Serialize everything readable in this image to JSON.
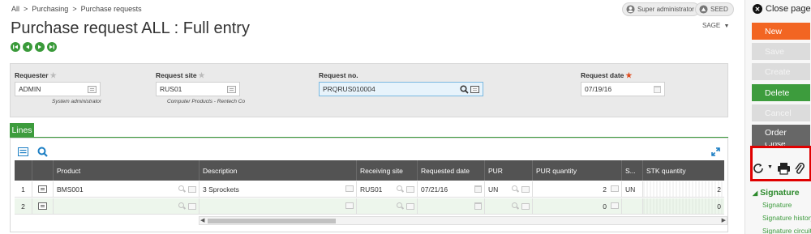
{
  "breadcrumb": [
    "All",
    "Purchasing",
    "Purchase requests"
  ],
  "breadcrumb_sep": ">",
  "user_badge": "Super administrator",
  "folder_badge": "SEED",
  "company_menu": "SAGE",
  "page_title": "Purchase request ALL : Full entry",
  "nav_buttons": [
    "first-record-icon",
    "previous-record-icon",
    "next-record-icon",
    "last-record-icon"
  ],
  "form": {
    "requester": {
      "label": "Requester",
      "value": "ADMIN",
      "desc": "System administrator"
    },
    "request_site": {
      "label": "Request site",
      "value": "RUS01",
      "desc": "Computer Products - Rentech Co"
    },
    "request_no": {
      "label": "Request no.",
      "value": "PRQRUS010004"
    },
    "request_date": {
      "label": "Request date",
      "value": "07/19/16"
    }
  },
  "lines_tab": "Lines",
  "grid": {
    "columns": [
      "Product",
      "Description",
      "Receiving site",
      "Requested date",
      "PUR",
      "PUR quantity",
      "S...",
      "STK quantity"
    ],
    "rows": [
      {
        "num": "1",
        "product": "BMS001",
        "description": "3 Sprockets",
        "site": "RUS01",
        "date": "07/21/16",
        "pur": "UN",
        "pur_qty": "2",
        "s": "UN",
        "stk_qty": "2"
      },
      {
        "num": "2",
        "product": "",
        "description": "",
        "site": "",
        "date": "",
        "pur": "",
        "pur_qty": "0",
        "s": "",
        "stk_qty": "0"
      }
    ]
  },
  "actions": {
    "close": "Close page",
    "new": "New",
    "save": "Save",
    "create": "Create",
    "delete": "Delete",
    "cancel": "Cancel",
    "order": "Order",
    "close_action": "Close"
  },
  "signature": {
    "heading": "Signature",
    "links": [
      "Signature",
      "Signature history",
      "Signature circuit"
    ]
  },
  "colors": {
    "accent_orange": "#f26522",
    "accent_green": "#3d9c3d",
    "highlight_red": "#e00000",
    "grid_header": "#535353"
  }
}
